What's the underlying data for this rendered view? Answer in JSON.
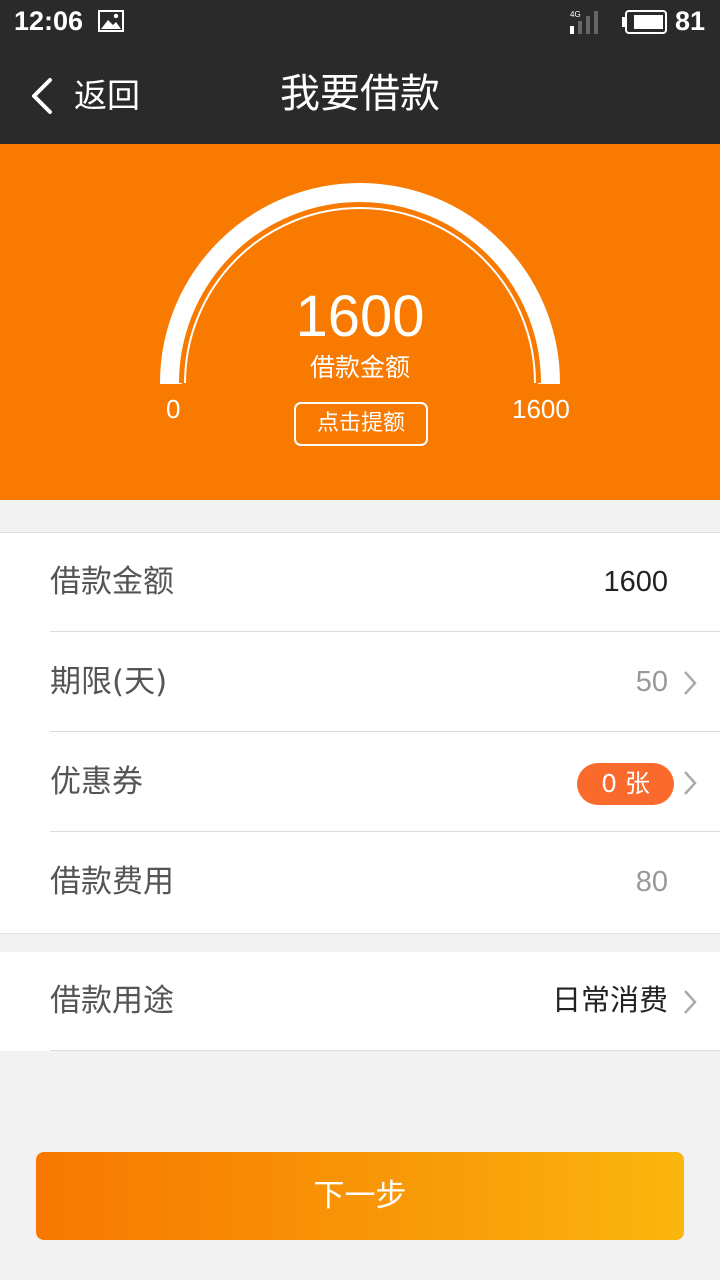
{
  "status_bar": {
    "time": "12:06",
    "network": "4G",
    "battery": "81"
  },
  "nav": {
    "back_label": "返回",
    "title": "我要借款"
  },
  "gauge": {
    "amount": "1600",
    "caption": "借款金额",
    "min_label": "0",
    "max_label": "1600",
    "raise_button": "点击提额",
    "fill_fraction": 1.0
  },
  "form": {
    "rows": [
      {
        "label": "借款金额",
        "value": "1600"
      },
      {
        "label": "期限(天)",
        "value": "50"
      },
      {
        "label": "优惠券",
        "value": "0 张"
      },
      {
        "label": "借款费用",
        "value": "80"
      }
    ],
    "purpose": {
      "label": "借款用途",
      "value": "日常消费"
    }
  },
  "next_button": "下一步",
  "colors": {
    "brand": "#f87a00",
    "badge": "#f96a2c",
    "navbar": "#2a2a2a"
  }
}
